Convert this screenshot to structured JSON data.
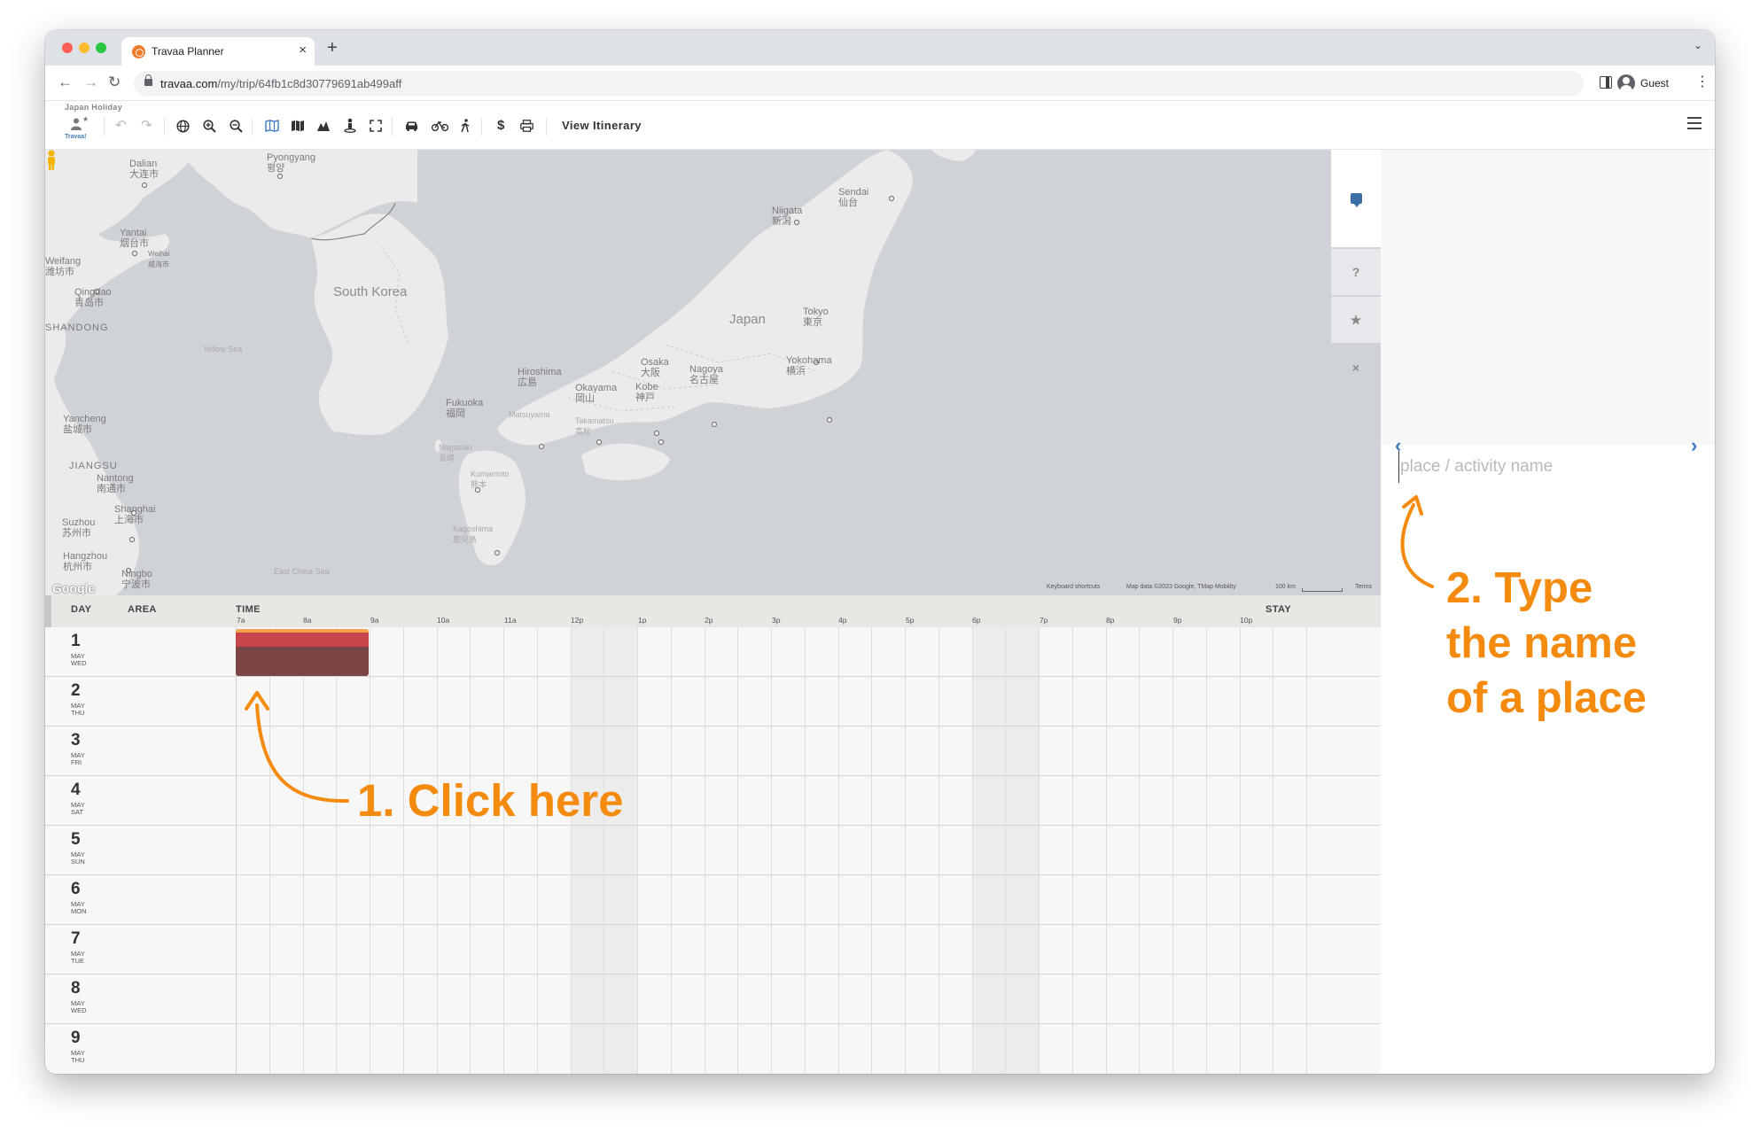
{
  "browser": {
    "tab_title": "Travaa Planner",
    "url_host": "travaa.com",
    "url_path": "/my/trip/64fb1c8d30779691ab499aff",
    "profile_label": "Guest"
  },
  "app": {
    "trip_title": "Japan Holiday",
    "logo_label": "Travaa!",
    "view_itinerary_label": "View Itinerary"
  },
  "map": {
    "labels": [
      {
        "text": "Dalian",
        "sub": "大连市"
      },
      {
        "text": "Pyongyang",
        "sub": "평양"
      },
      {
        "text": "Yantai",
        "sub": "烟台市"
      },
      {
        "text": "Weihai",
        "sub": "威海市"
      },
      {
        "text": "Qingdao",
        "sub": "青岛市"
      },
      {
        "text": "South Korea",
        "sub": ""
      },
      {
        "text": "Yellow Sea",
        "sub": ""
      },
      {
        "text": "Niigata",
        "sub": "新潟"
      },
      {
        "text": "Sendai",
        "sub": "仙台"
      },
      {
        "text": "Japan",
        "sub": ""
      },
      {
        "text": "Tokyo",
        "sub": "東京"
      },
      {
        "text": "Yokohama",
        "sub": "横浜"
      },
      {
        "text": "Nagoya",
        "sub": "名古屋"
      },
      {
        "text": "Osaka",
        "sub": "大阪"
      },
      {
        "text": "Kobe",
        "sub": "神戸"
      },
      {
        "text": "Okayama",
        "sub": "岡山"
      },
      {
        "text": "Hiroshima",
        "sub": "広島"
      },
      {
        "text": "Fukuoka",
        "sub": "福岡"
      },
      {
        "text": "Matsuyama",
        "sub": ""
      },
      {
        "text": "Takamatsu",
        "sub": "高松"
      },
      {
        "text": "Nagasaki",
        "sub": "長崎"
      },
      {
        "text": "Kagoshima",
        "sub": "鹿児島"
      },
      {
        "text": "Kumamoto",
        "sub": "熊本"
      },
      {
        "text": "Yancheng",
        "sub": "盐城市"
      },
      {
        "text": "JIANGSU",
        "sub": ""
      },
      {
        "text": "Nantong",
        "sub": "南通市"
      },
      {
        "text": "Shanghai",
        "sub": "上海市"
      },
      {
        "text": "Suzhou",
        "sub": "苏州市"
      },
      {
        "text": "Hangzhou",
        "sub": "杭州市"
      },
      {
        "text": "Ningbo",
        "sub": "宁波市"
      },
      {
        "text": "East China Sea",
        "sub": ""
      },
      {
        "text": "Weifang",
        "sub": "潍坊市"
      },
      {
        "text": "SHANDONG",
        "sub": ""
      }
    ],
    "google_label": "Google",
    "attribution": {
      "shortcuts": "Keyboard shortcuts",
      "data": "Map data ©2023 Google, TMap Mobility",
      "scale": "100 km",
      "terms": "Terms"
    },
    "side_tabs": {
      "help": "?",
      "star": "★",
      "close": "×"
    }
  },
  "panel": {
    "place_placeholder": "place / activity name"
  },
  "schedule": {
    "headers": {
      "day": "DAY",
      "area": "AREA",
      "time": "TIME",
      "stay": "STAY"
    },
    "hours": [
      "7a",
      "8a",
      "9a",
      "10a",
      "11a",
      "12p",
      "1p",
      "2p",
      "3p",
      "4p",
      "5p",
      "6p",
      "7p",
      "8p",
      "9p",
      "10p"
    ],
    "days": [
      {
        "num": "1",
        "month": "MAY",
        "dow": "WED"
      },
      {
        "num": "2",
        "month": "MAY",
        "dow": "THU"
      },
      {
        "num": "3",
        "month": "MAY",
        "dow": "FRI"
      },
      {
        "num": "4",
        "month": "MAY",
        "dow": "SAT"
      },
      {
        "num": "5",
        "month": "MAY",
        "dow": "SUN"
      },
      {
        "num": "6",
        "month": "MAY",
        "dow": "MON"
      },
      {
        "num": "7",
        "month": "MAY",
        "dow": "TUE"
      },
      {
        "num": "8",
        "month": "MAY",
        "dow": "WED"
      },
      {
        "num": "9",
        "month": "MAY",
        "dow": "THU"
      }
    ]
  },
  "annotations": {
    "step1": "1. Click here",
    "step2_line1": "2. Type",
    "step2_line2": "the name",
    "step2_line3": "of a place"
  },
  "colors": {
    "accent_annotation": "#f58b0e",
    "app_blue": "#3b78c2",
    "event_orange": "#f5a04b",
    "event_red": "#c9454c",
    "event_dark": "#7b4546"
  }
}
